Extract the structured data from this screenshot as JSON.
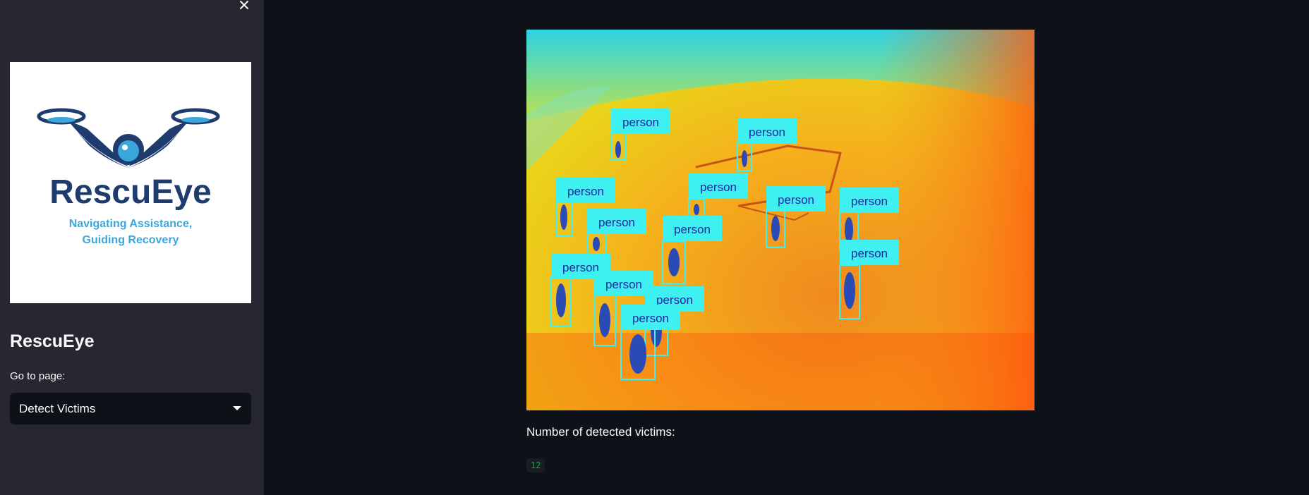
{
  "sidebar": {
    "logo": {
      "name": "RescuEye",
      "tagline_line1": "Navigating Assistance,",
      "tagline_line2": "Guiding Recovery"
    },
    "title": "RescuEye",
    "select_label": "Go to page:",
    "select_value": "Detect Victims"
  },
  "main": {
    "detection_label": "person",
    "result_label": "Number of detected victims:",
    "victim_count": "12"
  }
}
